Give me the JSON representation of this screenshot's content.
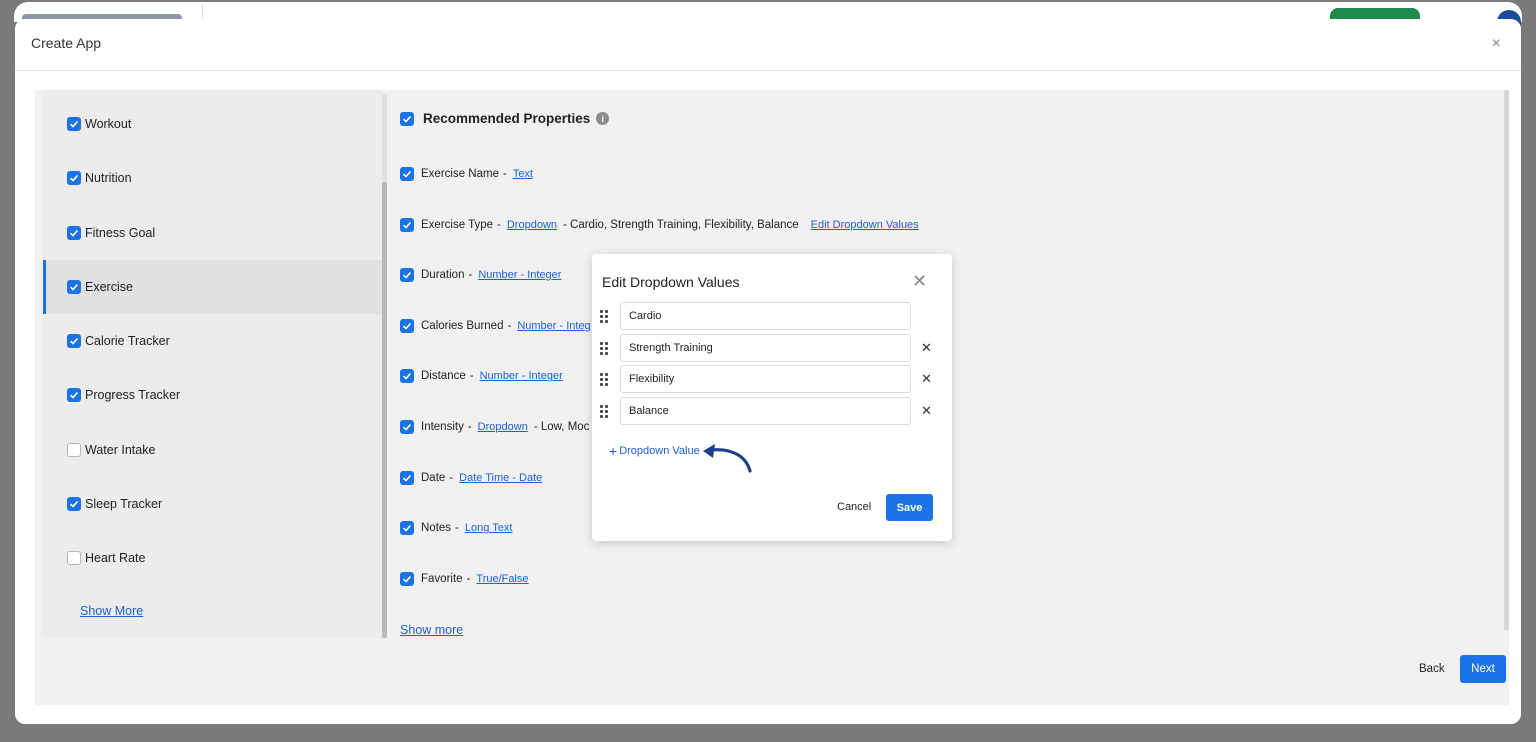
{
  "dialog": {
    "title": "Create App",
    "close_label": "×"
  },
  "categories": [
    {
      "label": "Workout",
      "checked": true
    },
    {
      "label": "Nutrition",
      "checked": true
    },
    {
      "label": "Fitness Goal",
      "checked": true
    },
    {
      "label": "Exercise",
      "checked": true,
      "active": true
    },
    {
      "label": "Calorie Tracker",
      "checked": true
    },
    {
      "label": "Progress Tracker",
      "checked": true
    },
    {
      "label": "Water Intake",
      "checked": false
    },
    {
      "label": "Sleep Tracker",
      "checked": true
    },
    {
      "label": "Heart Rate",
      "checked": false
    }
  ],
  "categories_show_more": "Show More",
  "properties": {
    "title": "Recommended Properties",
    "info_icon": "i",
    "separator": "-",
    "items": [
      {
        "name": "Exercise Name",
        "type": "Text",
        "values": "",
        "edit": ""
      },
      {
        "name": "Exercise Type",
        "type": "Dropdown",
        "values": "- Cardio, Strength Training, Flexibility, Balance",
        "edit": "Edit Dropdown Values"
      },
      {
        "name": "Duration",
        "type": "Number - Integer",
        "values": "",
        "edit": ""
      },
      {
        "name": "Calories Burned",
        "type": "Number - Integ",
        "values": "",
        "edit": ""
      },
      {
        "name": "Distance",
        "type": "Number - Integer",
        "values": "",
        "edit": ""
      },
      {
        "name": "Intensity",
        "type": "Dropdown",
        "values": "- Low, Moc",
        "edit": ""
      },
      {
        "name": "Date",
        "type": "Date Time - Date",
        "values": "",
        "edit": ""
      },
      {
        "name": "Notes",
        "type": "Long Text",
        "values": "",
        "edit": ""
      },
      {
        "name": "Favorite",
        "type": "True/False",
        "values": "",
        "edit": ""
      }
    ],
    "show_more": "Show more"
  },
  "footer": {
    "back_label": "Back",
    "next_label": "Next"
  },
  "edit_modal": {
    "title": "Edit Dropdown Values",
    "close_label": "✕",
    "values": [
      "Cardio",
      "Strength Training",
      "Flexibility",
      "Balance"
    ],
    "remove_label": "✕",
    "add_label": "Dropdown Value",
    "add_plus": "+",
    "cancel_label": "Cancel",
    "save_label": "Save"
  },
  "colors": {
    "accent": "#1c73e8",
    "link": "#1c5fd6",
    "arrow": "#1b3f8f"
  }
}
